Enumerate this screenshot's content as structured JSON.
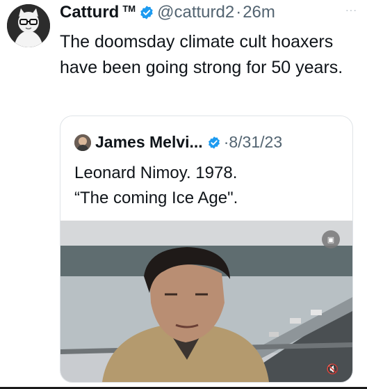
{
  "tweet": {
    "author_name": "Catturd",
    "author_tm": "TM",
    "handle": "@catturd2",
    "separator": "·",
    "time": "26m",
    "more": "···",
    "text": "The doomsday climate cult hoaxers have been going strong for 50 years."
  },
  "quoted": {
    "author_name": "James Melvi...",
    "separator": "·",
    "date": "8/31/23",
    "line1": "Leonard Nimoy. 1978.",
    "line2": "“The coming Ice Age\"."
  },
  "icons": {
    "verified": "verified-badge-icon",
    "more": "more-icon",
    "gif": "gif-icon",
    "volume": "mute-icon"
  },
  "colors": {
    "verified_blue": "#1d9bf0",
    "secondary_text": "#536471"
  }
}
